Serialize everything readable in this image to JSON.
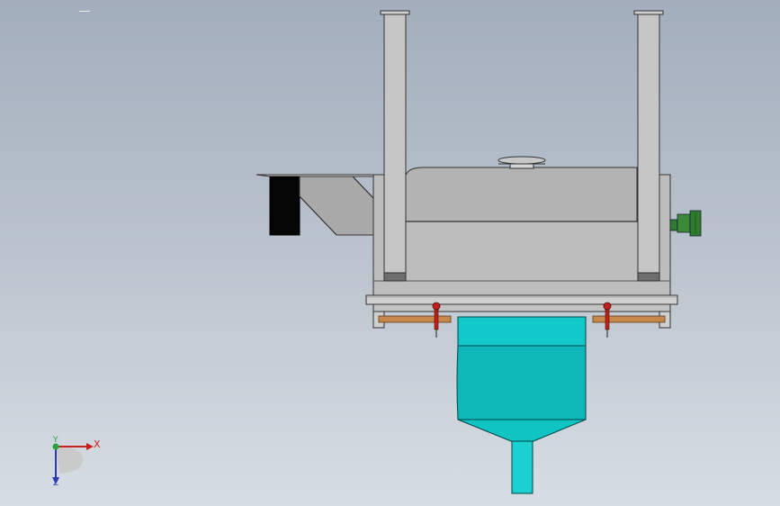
{
  "view": {
    "background_top": "#a3aebd",
    "background_bottom": "#d7dde4"
  },
  "triad": {
    "x_label": "X",
    "y_label": "Y",
    "z_label": "Z",
    "x_color": "#c8201c",
    "y_color": "#27a53a",
    "z_color": "#2a3bb6"
  },
  "model": {
    "body_color": "#bdbdbd",
    "hopper_color": "#0fbfbf",
    "flange_color": "#c8874a",
    "motor_color": "#2f7a2f",
    "bolt_color": "#c0201c"
  }
}
